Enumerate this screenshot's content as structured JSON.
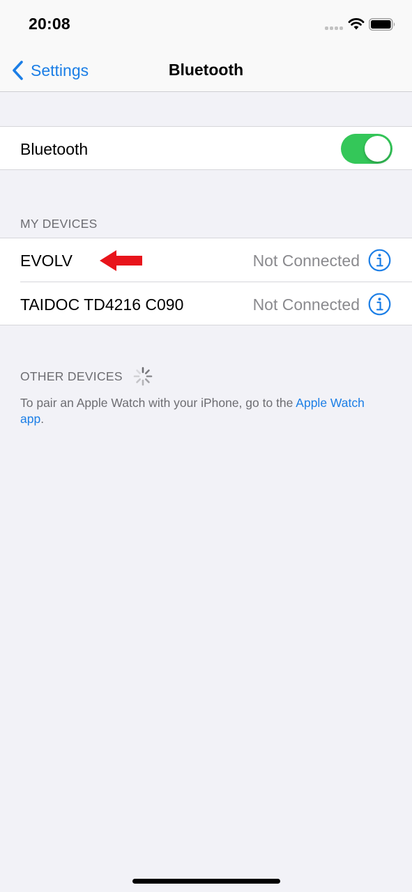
{
  "status_bar": {
    "time": "20:08",
    "icons": [
      "cellular-signal-icon",
      "wifi-icon",
      "battery-icon"
    ]
  },
  "nav": {
    "back_label": "Settings",
    "title": "Bluetooth",
    "back_icon": "chevron-left-icon"
  },
  "bluetooth": {
    "label": "Bluetooth",
    "enabled": true
  },
  "my_devices": {
    "header": "MY DEVICES",
    "items": [
      {
        "name": "EVOLV",
        "status": "Not Connected"
      },
      {
        "name": "TAIDOC TD4216 C090",
        "status": "Not Connected"
      }
    ]
  },
  "other_devices": {
    "header": "OTHER DEVICES",
    "footer_text": "To pair an Apple Watch with your iPhone, go to the ",
    "footer_link": "Apple Watch app",
    "footer_end": "."
  },
  "colors": {
    "accent": "#1b7ee6",
    "toggle_on": "#34c759",
    "annotation_arrow": "#e8141b",
    "background": "#f2f2f7"
  }
}
